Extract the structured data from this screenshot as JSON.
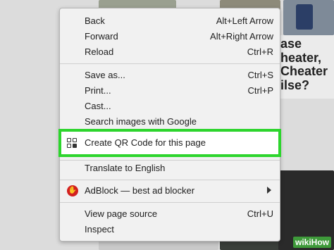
{
  "menu": {
    "items": [
      {
        "label": "Back",
        "shortcut": "Alt+Left Arrow"
      },
      {
        "label": "Forward",
        "shortcut": "Alt+Right Arrow"
      },
      {
        "label": "Reload",
        "shortcut": "Ctrl+R"
      },
      {
        "label": "Save as...",
        "shortcut": "Ctrl+S"
      },
      {
        "label": "Print...",
        "shortcut": "Ctrl+P"
      },
      {
        "label": "Cast...",
        "shortcut": ""
      },
      {
        "label": "Search images with Google",
        "shortcut": ""
      },
      {
        "label": "Create QR Code for this page",
        "shortcut": "",
        "icon": "qr-code-icon"
      },
      {
        "label": "Translate to English",
        "shortcut": ""
      },
      {
        "label": "AdBlock — best ad blocker",
        "shortcut": "",
        "icon": "adblock-icon",
        "submenu": true
      },
      {
        "label": "View page source",
        "shortcut": "Ctrl+U"
      },
      {
        "label": "Inspect",
        "shortcut": ""
      }
    ]
  },
  "background": {
    "headline_lines": [
      "ase",
      "heater,",
      "Cheater",
      "ilse?"
    ],
    "watermark": "wikiHow"
  },
  "colors": {
    "highlight": "#2dd52d",
    "adblock": "#d32020"
  }
}
